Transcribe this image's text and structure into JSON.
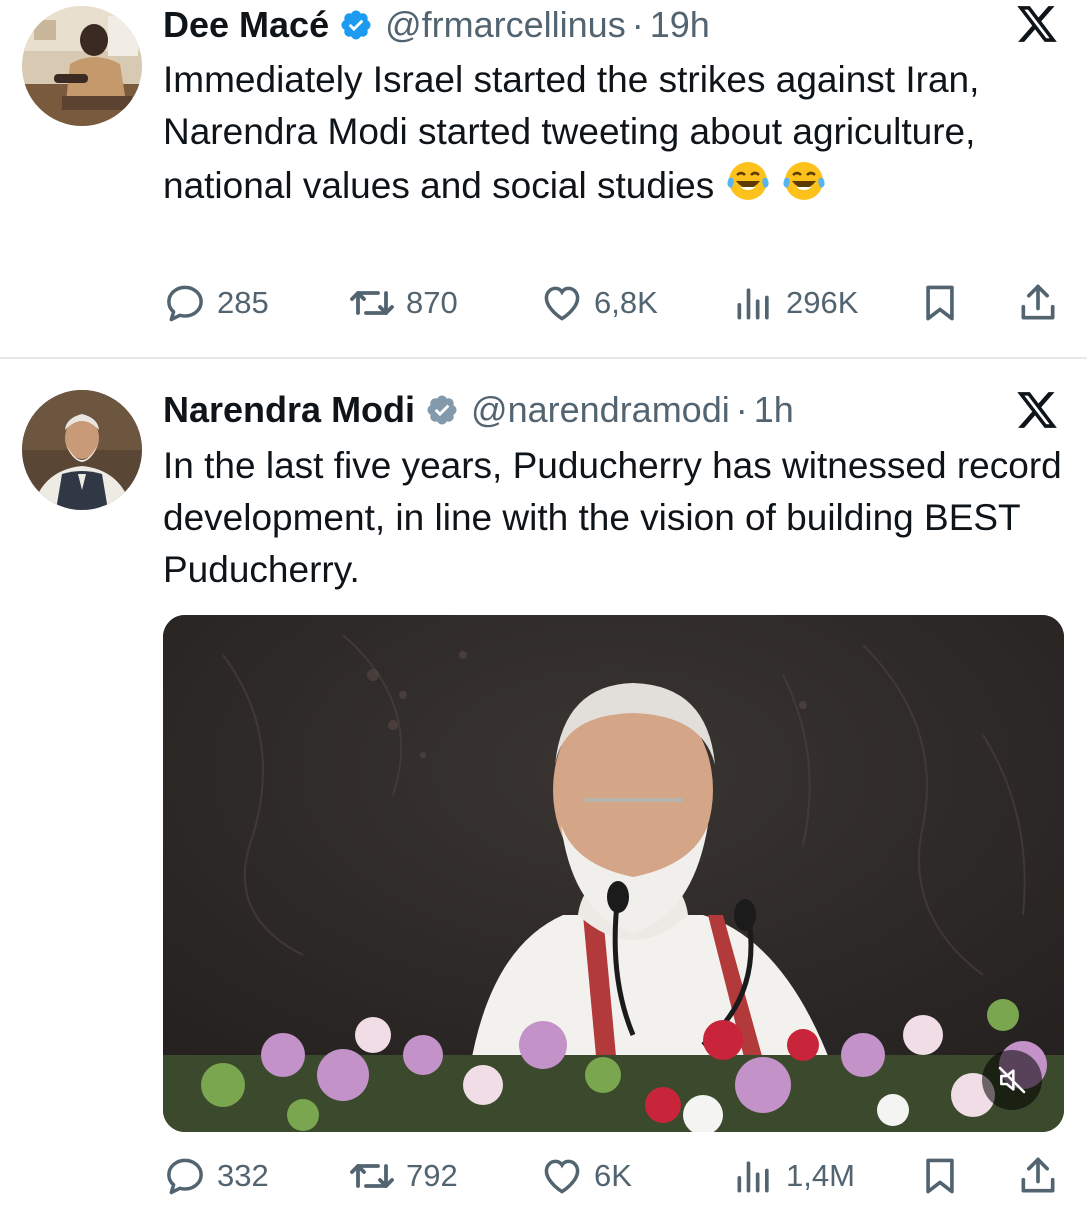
{
  "tweets": [
    {
      "author_name": "Dee Macé",
      "handle": "@frmarcellinus",
      "separator": "·",
      "time": "19h",
      "text": "Immediately Israel started the strikes against Iran, Narendra Modi started tweeting about agriculture, national values and social studies",
      "emoji": "😂",
      "replies": "285",
      "reposts": "870",
      "likes": "6,8K",
      "views": "296K"
    },
    {
      "author_name": "Narendra Modi",
      "handle": "@narendramodi",
      "separator": "·",
      "time": "1h",
      "text": "In the last five years, Puducherry has witnessed record development, in line with the vision of building BEST Puducherry.",
      "replies": "332",
      "reposts": "792",
      "likes": "6K",
      "views": "1,4M"
    }
  ],
  "icons": {
    "verified": "verified-badge-icon",
    "platform": "x-logo-icon",
    "reply": "reply-bubble-icon",
    "repost": "repost-arrows-icon",
    "like": "heart-icon",
    "views": "bar-chart-icon",
    "bookmark": "bookmark-icon",
    "share": "share-upload-icon",
    "mute": "speaker-muted-icon"
  },
  "colors": {
    "text_primary": "#0f1419",
    "text_secondary": "#536471",
    "verified_blue": "#1d9bf0",
    "divider": "#e6e8ea"
  }
}
